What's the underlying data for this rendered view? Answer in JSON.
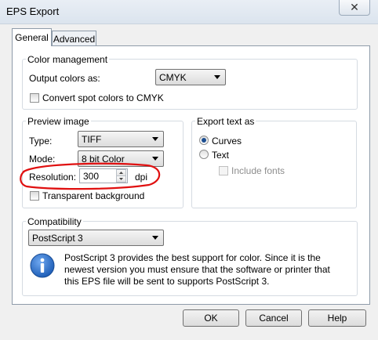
{
  "window": {
    "title": "EPS Export"
  },
  "tabs": [
    {
      "label": "General",
      "active": true
    },
    {
      "label": "Advanced",
      "active": false
    }
  ],
  "color_management": {
    "group_label": "Color management",
    "output_label": "Output colors as:",
    "output_value": "CMYK",
    "convert_spot_label": "Convert spot colors to CMYK",
    "convert_spot_checked": false
  },
  "preview_image": {
    "group_label": "Preview image",
    "type_label": "Type:",
    "type_value": "TIFF",
    "mode_label": "Mode:",
    "mode_value": "8 bit Color",
    "resolution_label": "Resolution:",
    "resolution_value": "300",
    "resolution_unit": "dpi",
    "transparent_label": "Transparent background",
    "transparent_checked": false
  },
  "export_text": {
    "group_label": "Export text as",
    "option_curves": "Curves",
    "option_text": "Text",
    "selected": "Curves",
    "include_fonts_label": "Include fonts",
    "include_fonts_enabled": false
  },
  "compatibility": {
    "group_label": "Compatibility",
    "value": "PostScript 3",
    "info_text": "PostScript 3 provides the best support for color. Since it is the newest version you must ensure that the software or printer that this EPS file will be sent to supports PostScript 3."
  },
  "buttons": {
    "ok": "OK",
    "cancel": "Cancel",
    "help": "Help"
  },
  "colors": {
    "highlight": "#e01010",
    "info_icon": "#1f5fb8"
  }
}
